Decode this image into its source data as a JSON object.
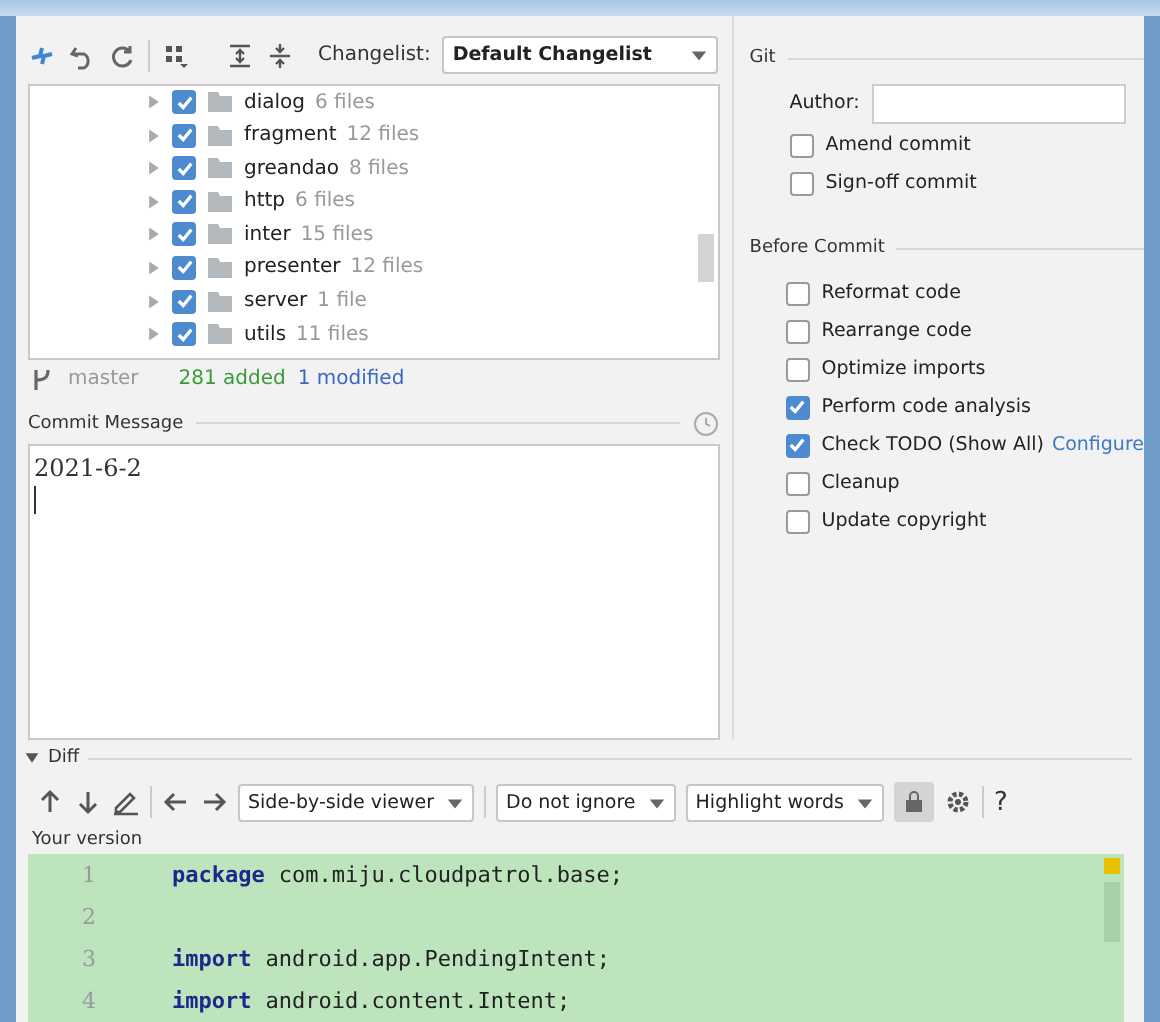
{
  "toolbar": {
    "changelist_label": "Changelist:",
    "changelist": "Default Changelist"
  },
  "tree": [
    {
      "name": "dialog",
      "count": "6 files",
      "checked": true
    },
    {
      "name": "fragment",
      "count": "12 files",
      "checked": true
    },
    {
      "name": "greandao",
      "count": "8 files",
      "checked": true
    },
    {
      "name": "http",
      "count": "6 files",
      "checked": true
    },
    {
      "name": "inter",
      "count": "15 files",
      "checked": true
    },
    {
      "name": "presenter",
      "count": "12 files",
      "checked": true
    },
    {
      "name": "server",
      "count": "1 file",
      "checked": true
    },
    {
      "name": "utils",
      "count": "11 files",
      "checked": true
    }
  ],
  "status": {
    "branch": "master",
    "added": "281 added",
    "modified": "1 modified"
  },
  "commit_message": {
    "label": "Commit Message",
    "value": "2021-6-2"
  },
  "git": {
    "title": "Git",
    "author_label": "Author:",
    "options": [
      {
        "label": "Amend commit",
        "checked": false
      },
      {
        "label": "Sign-off commit",
        "checked": false
      }
    ]
  },
  "before_commit": {
    "title": "Before Commit",
    "options": [
      {
        "label": "Reformat code",
        "checked": false
      },
      {
        "label": "Rearrange code",
        "checked": false
      },
      {
        "label": "Optimize imports",
        "checked": false
      },
      {
        "label": "Perform code analysis",
        "checked": true
      },
      {
        "label": "Check TODO (Show All)",
        "checked": true,
        "link": "Configure"
      },
      {
        "label": "Cleanup",
        "checked": false
      },
      {
        "label": "Update copyright",
        "checked": false
      }
    ]
  },
  "diff": {
    "title": "Diff",
    "expanded": true,
    "viewer": "Side-by-side viewer",
    "ignore": "Do not ignore",
    "highlight": "Highlight words",
    "help": "?",
    "side_label": "Your version",
    "lines": [
      {
        "number": "1",
        "keyword": "package",
        "rest": "com.miju.cloudpatrol.base;"
      },
      {
        "number": "2"
      },
      {
        "number": "3",
        "keyword": "import",
        "rest": "android.app.PendingIntent;"
      },
      {
        "number": "4",
        "keyword": "import",
        "rest": "android.content.Intent;"
      }
    ]
  }
}
